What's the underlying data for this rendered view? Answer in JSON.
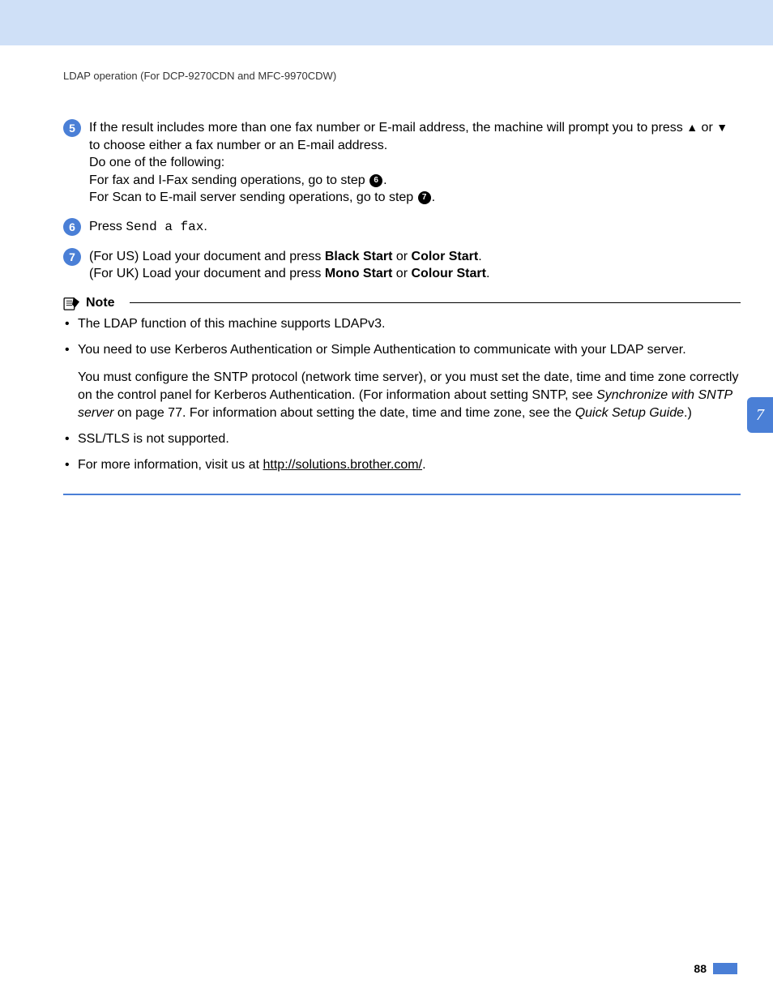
{
  "header": "LDAP operation (For DCP-9270CDN and MFC-9970CDW)",
  "steps": {
    "s5": {
      "num": "5",
      "line1a": "If the result includes more than one fax number or E-mail address, the machine will prompt you to press ",
      "up": "▲",
      "mid1": " or ",
      "down": "▼",
      "line1b": " to choose either a fax number or an E-mail address.",
      "line2": "Do one of the following:",
      "line3a": "For fax and I-Fax sending operations, go to step ",
      "ref6": "6",
      "line3b": ".",
      "line4a": "For Scan to E-mail server sending operations, go to step ",
      "ref7": "7",
      "line4b": "."
    },
    "s6": {
      "num": "6",
      "t1": "Press ",
      "cmd": "Send a fax",
      "t2": "."
    },
    "s7": {
      "num": "7",
      "us1": "(For US) Load your document and press ",
      "usb1": "Black Start",
      "usmid": " or ",
      "usb2": "Color Start",
      "usend": ".",
      "uk1": "(For UK) Load your document and press ",
      "ukb1": "Mono Start",
      "ukmid": " or ",
      "ukb2": "Colour Start",
      "ukend": "."
    }
  },
  "note": {
    "title": "Note",
    "b1": "The LDAP function of this machine supports LDAPv3.",
    "b2": "You need to use Kerberos Authentication or Simple Authentication to communicate with your LDAP server.",
    "b2sub_a": "You must configure the SNTP protocol (network time server), or you must set the date, time and time zone correctly on the control panel for Kerberos Authentication. (For information about setting SNTP, see ",
    "b2sub_i1": "Synchronize with SNTP server",
    "b2sub_b": " on page 77. For information about setting the date, time and time zone, see the ",
    "b2sub_i2": "Quick Setup Guide",
    "b2sub_c": ".)",
    "b3": "SSL/TLS is not supported.",
    "b4a": "For more information, visit us at ",
    "b4link": "http://solutions.brother.com/",
    "b4b": "."
  },
  "sideTab": "7",
  "pageNum": "88"
}
